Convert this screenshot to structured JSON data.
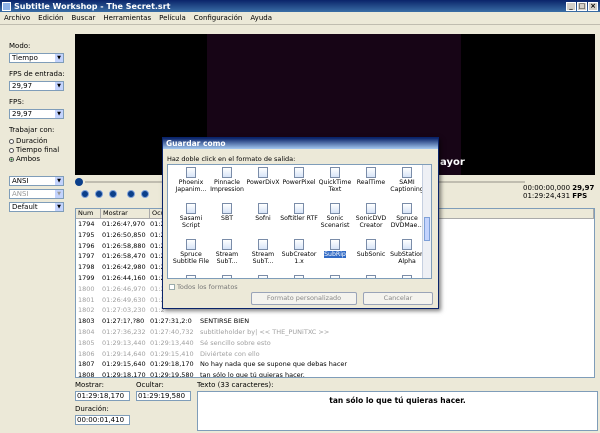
{
  "window": {
    "title": "Subtitle Workshop - The Secret.srt"
  },
  "menu": [
    "Archivo",
    "Edición",
    "Buscar",
    "Herramientas",
    "Película",
    "Configuración",
    "Ayuda"
  ],
  "left": {
    "mode_label": "Modo:",
    "mode_value": "Tiempo",
    "fps_input_label": "FPS de entrada:",
    "fps_input_value": "29,97",
    "fps_label": "FPS:",
    "fps_value": "29,97",
    "work_label": "Trabajar con:",
    "radios": [
      {
        "label": "Duración",
        "checked": false
      },
      {
        "label": "Tiempo final",
        "checked": false
      },
      {
        "label": "Ambos",
        "checked": true
      }
    ],
    "charset1": "ANSI",
    "charset2": "ANSI",
    "style": "Default"
  },
  "video": {
    "subtitle_text": "ayor"
  },
  "timecode": {
    "current": "00:00:00,000",
    "total": "01:29:24,431",
    "fps_value": "29,97",
    "fps_unit": "FPS"
  },
  "table": {
    "headers": [
      "Num",
      "Mostrar",
      "Ocult",
      ""
    ],
    "rows": [
      {
        "num": "1794",
        "show": "01:26:4?,970",
        "hide": "01:2",
        "text": "",
        "grey": false
      },
      {
        "num": "1795",
        "show": "01:26:50,850",
        "hide": "01:2",
        "text": "",
        "grey": false
      },
      {
        "num": "1796",
        "show": "01:26:58,880",
        "hide": "01:2",
        "text": "",
        "grey": false
      },
      {
        "num": "1797",
        "show": "01:26:58,470",
        "hide": "01:2",
        "text": "",
        "grey": false
      },
      {
        "num": "1798",
        "show": "01:26:42,980",
        "hide": "01:2",
        "text": "",
        "grey": false
      },
      {
        "num": "1799",
        "show": "01:26:44,160",
        "hide": "01:2",
        "text": "",
        "grey": false
      },
      {
        "num": "1800",
        "show": "01:26:46,970",
        "hide": "01:2",
        "text": "",
        "grey": true
      },
      {
        "num": "1801",
        "show": "01:26:49,630",
        "hide": "01:2",
        "text": "",
        "grey": true
      },
      {
        "num": "1802",
        "show": "01:27:03,230",
        "hide": "01:2",
        "text": "",
        "grey": true
      },
      {
        "num": "1803",
        "show": "01:27:1?,?80",
        "hide": "01:27:31,2:0",
        "text": "SENTIRSE BIEN",
        "grey": false
      },
      {
        "num": "1804",
        "show": "01:27:36,232",
        "hide": "01:27:40,732",
        "text": "subtitleholder by| << THE_PUNiTXC >>",
        "grey": true
      },
      {
        "num": "1805",
        "show": "01:29:13,440",
        "hide": "01:29:13,440",
        "text": "Sé sencillo sobre esto",
        "grey": true
      },
      {
        "num": "1806",
        "show": "01:29:14,640",
        "hide": "01:29:15,410",
        "text": "Diviértete con ello",
        "grey": true
      },
      {
        "num": "1807",
        "show": "01:29:15,640",
        "hide": "01:29:18,170",
        "text": "No hay nada que se supone que debas hacer",
        "grey": false
      },
      {
        "num": "1808",
        "show": "01:29:18,170",
        "hide": "01:29:19,580",
        "text": "tan sólo lo que tú quieras hacer.",
        "grey": false
      }
    ]
  },
  "bottom": {
    "show_label": "Mostrar:",
    "show_value": "01:29:18,170",
    "hide_label": "Ocultar:",
    "hide_value": "01:29:19,580",
    "duration_label": "Duración:",
    "duration_value": "00:00:01,410",
    "text_label": "Texto (33 caracteres):",
    "text_value": "tan sólo lo que tú quieras hacer."
  },
  "dialog": {
    "title": "Guardar como",
    "instruction": "Haz doble click en el formato de salida:",
    "formats": [
      "Phoenix Japanim...",
      "Pinnacle Impression",
      "PowerDivX",
      "PowerPixel",
      "QuickTime Text",
      "RealTime",
      "SAMI Captioning",
      "Sasami Script",
      "SBT",
      "Sofni",
      "Softitler RTF",
      "Sonic Scenarist",
      "SonicDVD Creator",
      "Spruce DVDMae...",
      "Spruce Subtitle File",
      "Stream SubT...",
      "Stream SubT...",
      "SubCreator 1.x",
      "SubRip",
      "SubSonic",
      "SubStation Alpha",
      "",
      "",
      "",
      "",
      "",
      "",
      ""
    ],
    "selected": "SubRip",
    "all_formats_label": "Todos los formatos",
    "custom_button": "Formato personalizado",
    "cancel_button": "Cancelar"
  }
}
